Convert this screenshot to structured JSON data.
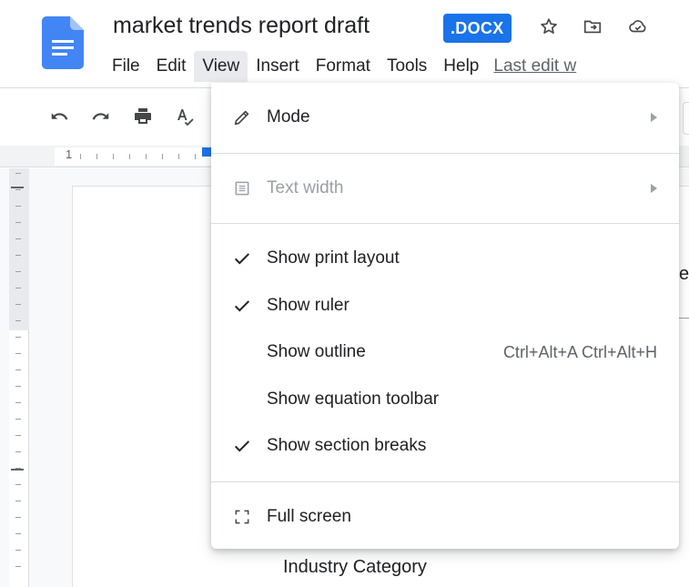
{
  "document": {
    "title": "market trends report draft",
    "format_badge": ".DOCX"
  },
  "header_icons": [
    "star-icon",
    "move-to-folder-icon",
    "cloud-saved-icon"
  ],
  "menubar": {
    "items": [
      {
        "label": "File"
      },
      {
        "label": "Edit"
      },
      {
        "label": "View",
        "active": true
      },
      {
        "label": "Insert"
      },
      {
        "label": "Format"
      },
      {
        "label": "Tools"
      },
      {
        "label": "Help"
      }
    ],
    "last_edit": "Last edit w"
  },
  "toolbar": {
    "buttons": [
      "undo-icon",
      "redo-icon",
      "print-icon",
      "spellcheck-icon"
    ]
  },
  "ruler": {
    "start_number": "1"
  },
  "view_menu": {
    "mode": {
      "label": "Mode",
      "icon": "pencil-icon",
      "has_submenu": true
    },
    "text_width": {
      "label": "Text width",
      "icon": "text-width-icon",
      "has_submenu": true,
      "disabled": true
    },
    "show_print_layout": {
      "label": "Show print layout",
      "checked": true
    },
    "show_ruler": {
      "label": "Show ruler",
      "checked": true
    },
    "show_outline": {
      "label": "Show outline",
      "checked": false,
      "shortcut": "Ctrl+Alt+A Ctrl+Alt+H"
    },
    "show_equation_toolbar": {
      "label": "Show equation toolbar",
      "checked": false
    },
    "show_section_breaks": {
      "label": "Show section breaks",
      "checked": true
    },
    "full_screen": {
      "label": "Full screen",
      "icon": "fullscreen-icon"
    }
  },
  "document_body": {
    "visible_line": "Industry Category",
    "partial_char": "e"
  },
  "colors": {
    "brand_blue": "#1a73e8",
    "docs_icon_blue": "#4285f4",
    "menu_active_bg": "#e8eaed",
    "text": "#202124",
    "muted": "#5f6368",
    "disabled": "#9aa0a6"
  }
}
